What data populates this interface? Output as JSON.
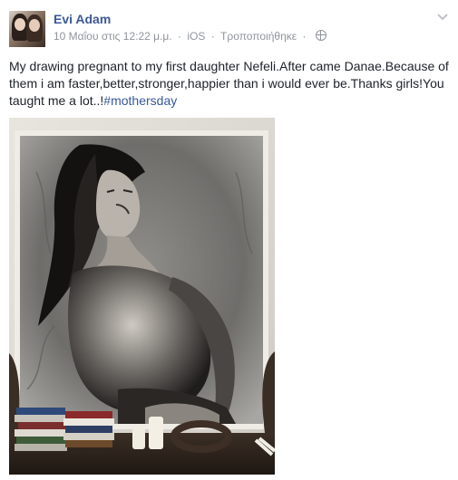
{
  "author": {
    "name": "Evi Adam"
  },
  "meta": {
    "date": "10 Μαΐου στις 12:22 μ.μ.",
    "separator": "·",
    "platform": "iOS",
    "edited": "Τροποποιήθηκε"
  },
  "post": {
    "text": "My drawing pregnant to my first daughter Nefeli.After came Danae.Because of them i am faster,better,stronger,happier than i would ever be.Thanks girls!You taught me a lot..!",
    "hashtag": "#mothersday"
  },
  "icons": {
    "options": "chevron-down-icon",
    "audience": "globe-icon"
  },
  "colors": {
    "link": "#3b5998",
    "meta": "#90949c",
    "text": "#1d2129"
  }
}
